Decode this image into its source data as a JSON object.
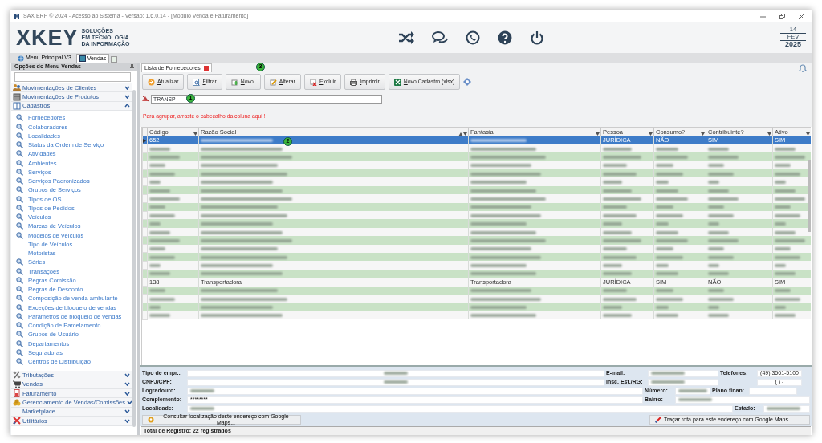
{
  "window": {
    "title": "SAX ERP © 2024 - Acesso ao Sistema - Versão: 1.6.0.14 - [Módulo Venda e Faturamento]"
  },
  "logo": {
    "name": "XKEY",
    "tagline": [
      "SOLUÇÕES",
      "EM TECNOLOGIA",
      "DA INFORMAÇÃO"
    ]
  },
  "date": {
    "day": "14",
    "month": "FEV",
    "year": "2025"
  },
  "app_tabs": [
    {
      "label": "Menu Principal V3",
      "selected": false
    },
    {
      "label": "Vendas",
      "selected": true
    }
  ],
  "sidebar": {
    "title": "Opções do Menu Vendas",
    "groups": [
      {
        "label": "Movimentações de Clientes",
        "expanded": false,
        "has_icon": true
      },
      {
        "label": "Movimentações de Produtos",
        "expanded": false,
        "has_icon": true
      },
      {
        "label": "Cadastros",
        "expanded": true,
        "has_icon": true,
        "children": [
          {
            "label": "Fornecedores",
            "has_icon": true
          },
          {
            "label": "Colaboradores",
            "has_icon": true
          },
          {
            "label": "Localidades",
            "has_icon": true
          },
          {
            "label": "Status da Ordem de Serviço",
            "has_icon": true
          },
          {
            "label": "Atividades",
            "has_icon": true
          },
          {
            "label": "Ambientes",
            "has_icon": true
          },
          {
            "label": "Serviços",
            "has_icon": true
          },
          {
            "label": "Serviços Padronizados",
            "has_icon": true
          },
          {
            "label": "Grupos de Serviços",
            "has_icon": true
          },
          {
            "label": "Tipos de OS",
            "has_icon": true
          },
          {
            "label": "Tipos de Pedidos",
            "has_icon": true
          },
          {
            "label": "Veículos",
            "has_icon": true
          },
          {
            "label": "Marcas de Veículos",
            "has_icon": true
          },
          {
            "label": "Modelos de Veículos",
            "has_icon": true
          },
          {
            "label": "Tipo de Veículos",
            "has_icon": false
          },
          {
            "label": "Motoristas",
            "has_icon": false
          },
          {
            "label": "Séries",
            "has_icon": true
          },
          {
            "label": "Transações",
            "has_icon": true
          },
          {
            "label": "Regras Comissão",
            "has_icon": true
          },
          {
            "label": "Regras de Desconto",
            "has_icon": true
          },
          {
            "label": "Composição de venda ambulante",
            "has_icon": true
          },
          {
            "label": "Exceções de bloqueio de vendas",
            "has_icon": true
          },
          {
            "label": "Parâmetros de bloqueio de vendas",
            "has_icon": true
          },
          {
            "label": "Condição de Parcelamento",
            "has_icon": true
          },
          {
            "label": "Grupos de Usuário",
            "has_icon": true
          },
          {
            "label": "Departamentos",
            "has_icon": true
          },
          {
            "label": "Seguradoras",
            "has_icon": true
          },
          {
            "label": "Centros de Distribuição",
            "has_icon": true
          }
        ]
      },
      {
        "label": "Tributações",
        "expanded": false,
        "has_icon": true
      },
      {
        "label": "Vendas",
        "expanded": false,
        "has_icon": true
      },
      {
        "label": "Faturamento",
        "expanded": false,
        "has_icon": true
      },
      {
        "label": "Gerenciamento de Vendas/Comissões",
        "expanded": false,
        "has_icon": true
      },
      {
        "label": "Marketplace",
        "expanded": false,
        "has_icon": false
      },
      {
        "label": "Utilitários",
        "expanded": false,
        "has_icon": true
      }
    ]
  },
  "document_tab": {
    "label": "Lista de Fornecedores"
  },
  "toolbar": [
    "Atualizar",
    "Filtrar",
    "Novo",
    "Alterar",
    "Excluir",
    "Imprimir",
    "Novo Cadastro (xlsx)"
  ],
  "filter": {
    "value": "TRANSP"
  },
  "group_hint": "Para agrupar, arraste o cabeçalho da coluna aqui !",
  "table": {
    "columns": [
      {
        "label": "Código",
        "sorted": false
      },
      {
        "label": "Razão Social",
        "sorted": true
      },
      {
        "label": "Fantasia",
        "sorted": false
      },
      {
        "label": "Pessoa",
        "sorted": false
      },
      {
        "label": "Consumo?",
        "sorted": false
      },
      {
        "label": "Contribuinte?",
        "sorted": false
      },
      {
        "label": "Ativo",
        "sorted": false
      }
    ],
    "rows": [
      {
        "selected": true,
        "cells": [
          "652",
          null,
          null,
          "JURÍDICA",
          "NÃO",
          "SIM",
          "SIM"
        ]
      },
      {
        "selected": false,
        "cells": [
          null,
          null,
          null,
          null,
          null,
          null,
          null
        ]
      },
      {
        "selected": false,
        "cells": [
          null,
          null,
          null,
          null,
          null,
          null,
          null
        ]
      },
      {
        "selected": false,
        "cells": [
          null,
          null,
          null,
          null,
          null,
          null,
          null
        ]
      },
      {
        "selected": false,
        "cells": [
          null,
          null,
          null,
          null,
          null,
          null,
          null
        ]
      },
      {
        "selected": false,
        "cells": [
          null,
          null,
          null,
          null,
          null,
          null,
          null
        ]
      },
      {
        "selected": false,
        "cells": [
          null,
          null,
          null,
          null,
          null,
          null,
          null
        ]
      },
      {
        "selected": false,
        "cells": [
          null,
          null,
          null,
          null,
          null,
          null,
          null
        ]
      },
      {
        "selected": false,
        "cells": [
          null,
          null,
          null,
          null,
          null,
          null,
          null
        ]
      },
      {
        "selected": false,
        "cells": [
          null,
          null,
          null,
          null,
          null,
          null,
          null
        ]
      },
      {
        "selected": false,
        "cells": [
          null,
          null,
          null,
          null,
          null,
          null,
          null
        ]
      },
      {
        "selected": false,
        "cells": [
          null,
          null,
          null,
          null,
          null,
          null,
          null
        ]
      },
      {
        "selected": false,
        "cells": [
          null,
          null,
          null,
          null,
          null,
          null,
          null
        ]
      },
      {
        "selected": false,
        "cells": [
          null,
          null,
          null,
          null,
          null,
          null,
          null
        ]
      },
      {
        "selected": false,
        "cells": [
          null,
          null,
          null,
          null,
          null,
          null,
          null
        ]
      },
      {
        "selected": false,
        "cells": [
          null,
          null,
          null,
          null,
          null,
          null,
          null
        ]
      },
      {
        "selected": false,
        "cells": [
          null,
          null,
          null,
          null,
          null,
          null,
          null
        ]
      },
      {
        "selected": false,
        "cells": [
          "138",
          "Transportadora",
          "Transportadora",
          "JURÍDICA",
          "SIM",
          "NÃO",
          "SIM"
        ]
      },
      {
        "selected": false,
        "cells": [
          null,
          null,
          null,
          null,
          null,
          null,
          null
        ]
      },
      {
        "selected": false,
        "cells": [
          null,
          null,
          null,
          null,
          null,
          null,
          null
        ]
      },
      {
        "selected": false,
        "cells": [
          null,
          null,
          null,
          null,
          null,
          null,
          null
        ]
      },
      {
        "selected": false,
        "cells": [
          null,
          null,
          null,
          null,
          null,
          null,
          null
        ]
      }
    ]
  },
  "markers": [
    {
      "label": "1"
    },
    {
      "label": "2"
    },
    {
      "label": "3"
    }
  ],
  "details": {
    "rows": [
      [
        {
          "label": "Tipo de empr.:",
          "blurred": true
        },
        {
          "label": "E-mail:",
          "blurred": true
        },
        {
          "label": "Telefones:",
          "value": "(49) 3561-5100"
        }
      ],
      [
        {
          "label": "CNPJ/CPF:",
          "blurred": true
        },
        {
          "label": "Insc. Est./RG:",
          "blurred": true
        },
        {
          "value": "( )  -"
        }
      ],
      [
        {
          "label": "Logradouro:",
          "blurred": true
        },
        {
          "label": "Número:",
          "blurred": true
        },
        {
          "label": "Plano finan:"
        }
      ],
      [
        {
          "label": "Complemento:",
          "value": "********"
        },
        {
          "label": "Bairro:",
          "blurred": true
        }
      ],
      [
        {
          "label": "Localidade:",
          "blurred": true
        },
        {
          "label": "Estado:",
          "blurred": true
        }
      ]
    ],
    "buttons": [
      "Consultar localização deste endereço com Google Maps...",
      "Traçar rota para este endereço com Google Maps..."
    ]
  },
  "status_bar": "Total de Registro: 22 registrados"
}
